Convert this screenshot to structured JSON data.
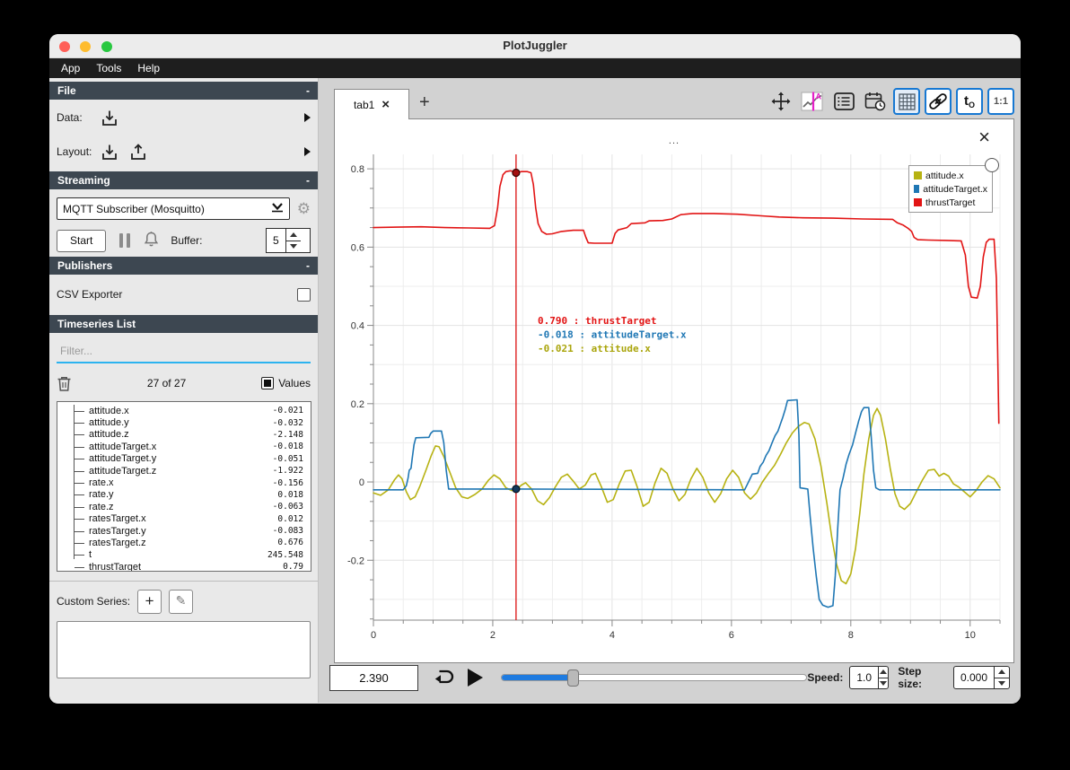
{
  "window": {
    "title": "PlotJuggler",
    "menu": [
      "App",
      "Tools",
      "Help"
    ]
  },
  "sidebar": {
    "file": {
      "header": "File",
      "collapse": "-",
      "data_label": "Data:",
      "layout_label": "Layout:"
    },
    "streaming": {
      "header": "Streaming",
      "collapse": "-",
      "source": "MQTT Subscriber (Mosquitto)",
      "start_label": "Start",
      "buffer_label": "Buffer:",
      "buffer_value": "5"
    },
    "publishers": {
      "header": "Publishers",
      "collapse": "-",
      "csv_exporter": "CSV Exporter"
    },
    "timeseries": {
      "header": "Timeseries List",
      "filter_placeholder": "Filter...",
      "count": "27 of 27",
      "values_label": "Values",
      "items": [
        {
          "name": "attitude.x",
          "value": "-0.021"
        },
        {
          "name": "attitude.y",
          "value": "-0.032"
        },
        {
          "name": "attitude.z",
          "value": "-2.148"
        },
        {
          "name": "attitudeTarget.x",
          "value": "-0.018"
        },
        {
          "name": "attitudeTarget.y",
          "value": "-0.051"
        },
        {
          "name": "attitudeTarget.z",
          "value": "-1.922"
        },
        {
          "name": "rate.x",
          "value": "-0.156"
        },
        {
          "name": "rate.y",
          "value": "0.018"
        },
        {
          "name": "rate.z",
          "value": "-0.063"
        },
        {
          "name": "ratesTarget.x",
          "value": "0.012"
        },
        {
          "name": "ratesTarget.y",
          "value": "-0.083"
        },
        {
          "name": "ratesTarget.z",
          "value": "0.676"
        },
        {
          "name": "t",
          "value": "245.548"
        },
        {
          "name": "thrustTarget",
          "value": "0.79"
        }
      ]
    },
    "custom_series": {
      "label": "Custom Series:",
      "add_glyph": "+",
      "edit_glyph": "✎"
    }
  },
  "main": {
    "tab": "tab1",
    "tab_close": "×",
    "new_tab": "+",
    "plot_title": "...",
    "plot_close": "×",
    "toolbar": {
      "t0": "t",
      "t0_sub": "O",
      "ratio": "1:1"
    },
    "legend": [
      {
        "label": "attitude.x",
        "color": "#b7b212"
      },
      {
        "label": "attitudeTarget.x",
        "color": "#1f77b4"
      },
      {
        "label": "thrustTarget",
        "color": "#e21414"
      }
    ]
  },
  "playback": {
    "time": "2.390",
    "slider_fraction": 0.234,
    "speed_label": "Speed:",
    "speed": "1.0",
    "step_label": "Step size:",
    "step": "0.000"
  },
  "chart_data": {
    "type": "line",
    "title": "...",
    "xlabel": "",
    "ylabel": "",
    "xlim": [
      0,
      10.5
    ],
    "ylim": [
      -0.353,
      0.837
    ],
    "xticks": [
      0,
      2,
      4,
      6,
      8,
      10
    ],
    "yticks": [
      -0.2,
      0,
      0.2,
      0.4,
      0.6,
      0.8
    ],
    "grid": {
      "x_step": 0.5,
      "y_step": 0.1,
      "x_minor_tick": 0.5,
      "y_minor_tick": 0.05
    },
    "legend_position": "top-right",
    "cursor": {
      "x": 2.39,
      "line_color": "#dd1111",
      "markers": [
        {
          "series": "thrustTarget",
          "y": 0.79,
          "fill": "#a50f0f",
          "stroke": "#3a0000"
        },
        {
          "series": "attitudeTarget.x",
          "y": -0.018,
          "fill": "#12395c",
          "stroke": "#04111f"
        }
      ],
      "readouts": [
        {
          "value": 0.79,
          "text": " 0.790 : thrustTarget",
          "color": "#e21414"
        },
        {
          "value": -0.018,
          "text": "-0.018 : attitudeTarget.x",
          "color": "#1f77b4"
        },
        {
          "value": -0.021,
          "text": "-0.021 : attitude.x",
          "color": "#aaa50c"
        }
      ]
    },
    "series": [
      {
        "name": "attitude.x",
        "color": "#b7b212",
        "points": [
          [
            0,
            -0.028
          ],
          [
            0.12,
            -0.034
          ],
          [
            0.25,
            -0.02
          ],
          [
            0.35,
            0.005
          ],
          [
            0.42,
            0.018
          ],
          [
            0.48,
            0.008
          ],
          [
            0.55,
            -0.025
          ],
          [
            0.62,
            -0.045
          ],
          [
            0.7,
            -0.038
          ],
          [
            0.78,
            -0.01
          ],
          [
            0.88,
            0.03
          ],
          [
            0.97,
            0.068
          ],
          [
            1.04,
            0.092
          ],
          [
            1.1,
            0.09
          ],
          [
            1.18,
            0.065
          ],
          [
            1.28,
            0.025
          ],
          [
            1.38,
            -0.015
          ],
          [
            1.48,
            -0.038
          ],
          [
            1.58,
            -0.042
          ],
          [
            1.7,
            -0.032
          ],
          [
            1.82,
            -0.018
          ],
          [
            1.93,
            0.005
          ],
          [
            2.02,
            0.018
          ],
          [
            2.12,
            0.008
          ],
          [
            2.22,
            -0.015
          ],
          [
            2.32,
            -0.022
          ],
          [
            2.39,
            -0.021
          ],
          [
            2.48,
            -0.008
          ],
          [
            2.55,
            -0.002
          ],
          [
            2.65,
            -0.018
          ],
          [
            2.75,
            -0.048
          ],
          [
            2.85,
            -0.058
          ],
          [
            2.95,
            -0.04
          ],
          [
            3.05,
            -0.012
          ],
          [
            3.15,
            0.012
          ],
          [
            3.25,
            0.02
          ],
          [
            3.35,
            0.002
          ],
          [
            3.45,
            -0.018
          ],
          [
            3.55,
            -0.008
          ],
          [
            3.65,
            0.018
          ],
          [
            3.72,
            0.022
          ],
          [
            3.82,
            -0.012
          ],
          [
            3.92,
            -0.052
          ],
          [
            4.02,
            -0.045
          ],
          [
            4.12,
            -0.005
          ],
          [
            4.22,
            0.028
          ],
          [
            4.32,
            0.03
          ],
          [
            4.42,
            -0.012
          ],
          [
            4.52,
            -0.062
          ],
          [
            4.62,
            -0.052
          ],
          [
            4.72,
            -0.002
          ],
          [
            4.82,
            0.035
          ],
          [
            4.92,
            0.022
          ],
          [
            5.02,
            -0.018
          ],
          [
            5.12,
            -0.048
          ],
          [
            5.22,
            -0.032
          ],
          [
            5.32,
            0.008
          ],
          [
            5.42,
            0.035
          ],
          [
            5.52,
            0.012
          ],
          [
            5.62,
            -0.028
          ],
          [
            5.72,
            -0.052
          ],
          [
            5.82,
            -0.03
          ],
          [
            5.92,
            0.008
          ],
          [
            6.02,
            0.03
          ],
          [
            6.12,
            0.012
          ],
          [
            6.22,
            -0.028
          ],
          [
            6.32,
            -0.044
          ],
          [
            6.42,
            -0.028
          ],
          [
            6.52,
            0
          ],
          [
            6.62,
            0.022
          ],
          [
            6.72,
            0.042
          ],
          [
            6.82,
            0.07
          ],
          [
            6.92,
            0.1
          ],
          [
            7.02,
            0.125
          ],
          [
            7.12,
            0.142
          ],
          [
            7.22,
            0.152
          ],
          [
            7.3,
            0.148
          ],
          [
            7.4,
            0.11
          ],
          [
            7.5,
            0.04
          ],
          [
            7.6,
            -0.055
          ],
          [
            7.68,
            -0.14
          ],
          [
            7.76,
            -0.21
          ],
          [
            7.84,
            -0.252
          ],
          [
            7.92,
            -0.26
          ],
          [
            8,
            -0.235
          ],
          [
            8.08,
            -0.17
          ],
          [
            8.15,
            -0.08
          ],
          [
            8.22,
            0.02
          ],
          [
            8.3,
            0.11
          ],
          [
            8.38,
            0.17
          ],
          [
            8.44,
            0.188
          ],
          [
            8.5,
            0.17
          ],
          [
            8.58,
            0.11
          ],
          [
            8.66,
            0.035
          ],
          [
            8.74,
            -0.03
          ],
          [
            8.82,
            -0.062
          ],
          [
            8.9,
            -0.07
          ],
          [
            9,
            -0.055
          ],
          [
            9.1,
            -0.025
          ],
          [
            9.2,
            0.005
          ],
          [
            9.3,
            0.03
          ],
          [
            9.4,
            0.032
          ],
          [
            9.48,
            0.015
          ],
          [
            9.56,
            0.022
          ],
          [
            9.64,
            0.015
          ],
          [
            9.72,
            -0.005
          ],
          [
            9.8,
            -0.012
          ],
          [
            9.9,
            -0.025
          ],
          [
            10,
            -0.038
          ],
          [
            10.1,
            -0.022
          ],
          [
            10.2,
            0
          ],
          [
            10.3,
            0.016
          ],
          [
            10.4,
            0.008
          ],
          [
            10.5,
            -0.015
          ]
        ]
      },
      {
        "name": "attitudeTarget.x",
        "color": "#1f77b4",
        "points": [
          [
            0,
            -0.02
          ],
          [
            0.5,
            -0.02
          ],
          [
            0.55,
            -0.01
          ],
          [
            0.58,
            0.01
          ],
          [
            0.6,
            0.03
          ],
          [
            0.63,
            0.035
          ],
          [
            0.65,
            0.06
          ],
          [
            0.68,
            0.095
          ],
          [
            0.71,
            0.113
          ],
          [
            0.93,
            0.114
          ],
          [
            0.96,
            0.124
          ],
          [
            1,
            0.13
          ],
          [
            1.14,
            0.13
          ],
          [
            1.18,
            0.1
          ],
          [
            1.22,
            0.03
          ],
          [
            1.26,
            -0.018
          ],
          [
            2.39,
            -0.018
          ],
          [
            6.22,
            -0.02
          ],
          [
            6.27,
            -0.005
          ],
          [
            6.31,
            0.008
          ],
          [
            6.35,
            0.02
          ],
          [
            6.44,
            0.022
          ],
          [
            6.48,
            0.04
          ],
          [
            6.53,
            0.05
          ],
          [
            6.58,
            0.068
          ],
          [
            6.63,
            0.08
          ],
          [
            6.68,
            0.1
          ],
          [
            6.73,
            0.118
          ],
          [
            6.78,
            0.13
          ],
          [
            6.82,
            0.148
          ],
          [
            6.86,
            0.165
          ],
          [
            6.9,
            0.185
          ],
          [
            6.94,
            0.208
          ],
          [
            7.1,
            0.21
          ],
          [
            7.13,
            0.12
          ],
          [
            7.15,
            -0.015
          ],
          [
            7.28,
            -0.018
          ],
          [
            7.32,
            -0.09
          ],
          [
            7.37,
            -0.17
          ],
          [
            7.42,
            -0.24
          ],
          [
            7.47,
            -0.3
          ],
          [
            7.53,
            -0.315
          ],
          [
            7.62,
            -0.32
          ],
          [
            7.7,
            -0.316
          ],
          [
            7.74,
            -0.24
          ],
          [
            7.78,
            -0.12
          ],
          [
            7.82,
            -0.02
          ],
          [
            7.87,
            0.01
          ],
          [
            7.92,
            0.045
          ],
          [
            7.97,
            0.07
          ],
          [
            8.03,
            0.095
          ],
          [
            8.08,
            0.125
          ],
          [
            8.13,
            0.155
          ],
          [
            8.18,
            0.18
          ],
          [
            8.22,
            0.19
          ],
          [
            8.3,
            0.19
          ],
          [
            8.34,
            0.12
          ],
          [
            8.38,
            0.03
          ],
          [
            8.42,
            -0.015
          ],
          [
            8.48,
            -0.02
          ],
          [
            10.5,
            -0.02
          ]
        ]
      },
      {
        "name": "thrustTarget",
        "color": "#e21414",
        "points": [
          [
            0,
            0.65
          ],
          [
            0.4,
            0.651
          ],
          [
            0.8,
            0.652
          ],
          [
            1.2,
            0.65
          ],
          [
            1.6,
            0.649
          ],
          [
            1.95,
            0.648
          ],
          [
            2.03,
            0.655
          ],
          [
            2.08,
            0.7
          ],
          [
            2.12,
            0.755
          ],
          [
            2.17,
            0.785
          ],
          [
            2.22,
            0.793
          ],
          [
            2.3,
            0.795
          ],
          [
            2.39,
            0.79
          ],
          [
            2.48,
            0.793
          ],
          [
            2.58,
            0.793
          ],
          [
            2.64,
            0.79
          ],
          [
            2.68,
            0.76
          ],
          [
            2.72,
            0.7
          ],
          [
            2.76,
            0.66
          ],
          [
            2.82,
            0.64
          ],
          [
            2.9,
            0.633
          ],
          [
            3,
            0.634
          ],
          [
            3.15,
            0.64
          ],
          [
            3.35,
            0.643
          ],
          [
            3.52,
            0.643
          ],
          [
            3.56,
            0.625
          ],
          [
            3.6,
            0.611
          ],
          [
            3.7,
            0.61
          ],
          [
            4,
            0.61
          ],
          [
            4.05,
            0.635
          ],
          [
            4.1,
            0.644
          ],
          [
            4.25,
            0.65
          ],
          [
            4.32,
            0.66
          ],
          [
            4.55,
            0.662
          ],
          [
            4.62,
            0.667
          ],
          [
            4.85,
            0.668
          ],
          [
            5,
            0.672
          ],
          [
            5.15,
            0.683
          ],
          [
            5.35,
            0.686
          ],
          [
            5.7,
            0.686
          ],
          [
            6.1,
            0.684
          ],
          [
            6.5,
            0.68
          ],
          [
            6.8,
            0.677
          ],
          [
            7.2,
            0.675
          ],
          [
            7.7,
            0.674
          ],
          [
            8.2,
            0.672
          ],
          [
            8.7,
            0.671
          ],
          [
            8.78,
            0.662
          ],
          [
            8.88,
            0.656
          ],
          [
            8.96,
            0.648
          ],
          [
            9.02,
            0.64
          ],
          [
            9.06,
            0.625
          ],
          [
            9.12,
            0.619
          ],
          [
            9.3,
            0.618
          ],
          [
            9.6,
            0.617
          ],
          [
            9.85,
            0.616
          ],
          [
            9.92,
            0.58
          ],
          [
            9.97,
            0.5
          ],
          [
            10.02,
            0.472
          ],
          [
            10.12,
            0.47
          ],
          [
            10.17,
            0.5
          ],
          [
            10.22,
            0.575
          ],
          [
            10.27,
            0.612
          ],
          [
            10.32,
            0.62
          ],
          [
            10.4,
            0.62
          ],
          [
            10.44,
            0.52
          ],
          [
            10.46,
            0.35
          ],
          [
            10.48,
            0.15
          ]
        ]
      }
    ]
  }
}
